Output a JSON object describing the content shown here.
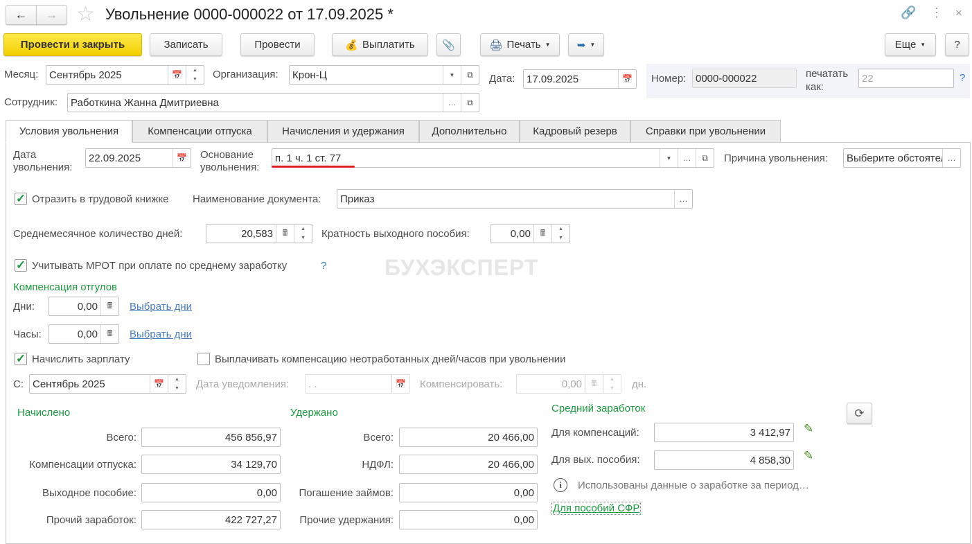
{
  "title": "Увольнение 0000-000022 от 17.09.2025 *",
  "toolbar": {
    "post_close": "Провести и закрыть",
    "save": "Записать",
    "post": "Провести",
    "pay": "Выплатить",
    "print": "Печать",
    "more": "Еще",
    "help": "?"
  },
  "header": {
    "month_label": "Месяц:",
    "month": "Сентябрь 2025",
    "org_label": "Организация:",
    "org": "Крон-Ц",
    "date_label": "Дата:",
    "date": "17.09.2025",
    "number_label": "Номер:",
    "number": "0000-000022",
    "print_as_label": "печатать как:",
    "print_as": "22",
    "help": "?",
    "employee_label": "Сотрудник:",
    "employee": "Работкина Жанна Дмитриевна"
  },
  "tabs": [
    "Условия увольнения",
    "Компенсации отпуска",
    "Начисления и удержания",
    "Дополнительно",
    "Кадровый резерв",
    "Справки при увольнении"
  ],
  "form": {
    "dismissal_date_label": "Дата увольнения:",
    "dismissal_date": "22.09.2025",
    "basis_label": "Основание увольнения:",
    "basis": "п. 1 ч. 1 ст. 77",
    "reason_label": "Причина увольнения:",
    "reason": "Выберите обстоятельства",
    "workbook_label": "Отразить в трудовой книжке",
    "workbook_checked": true,
    "docname_label": "Наименование документа:",
    "docname": "Приказ",
    "avg_days_label": "Среднемесячное количество дней:",
    "avg_days": "20,583",
    "severance_mult_label": "Кратность выходного пособия:",
    "severance_mult": "0,00",
    "mrot_label": "Учитывать МРОТ при оплате по среднему заработку",
    "mrot_checked": true,
    "mrot_help": "?",
    "timeoff_title": "Компенсация отгулов",
    "days_label": "Дни:",
    "days": "0,00",
    "hours_label": "Часы:",
    "hours": "0,00",
    "choose_days": "Выбрать дни",
    "accrue_label": "Начислить зарплату",
    "accrue_checked": true,
    "pay_comp_label": "Выплачивать компенсацию неотработанных дней/часов при увольнении",
    "pay_comp_checked": false,
    "from_label": "С:",
    "from": "Сентябрь 2025",
    "notice_label": "Дата уведомления:",
    "notice": " .  .",
    "compensate_label": "Компенсировать:",
    "compensate": "0,00",
    "days_unit": "дн."
  },
  "accrued": {
    "title": "Начислено",
    "rows": [
      {
        "label": "Всего:",
        "value": "456 856,97"
      },
      {
        "label": "Компенсации отпуска:",
        "value": "34 129,70"
      },
      {
        "label": "Выходное пособие:",
        "value": "0,00"
      },
      {
        "label": "Прочий заработок:",
        "value": "422 727,27"
      }
    ]
  },
  "withheld": {
    "title": "Удержано",
    "rows": [
      {
        "label": "Всего:",
        "value": "20 466,00"
      },
      {
        "label": "НДФЛ:",
        "value": "20 466,00"
      },
      {
        "label": "Погашение займов:",
        "value": "0,00"
      },
      {
        "label": "Прочие удержания:",
        "value": "0,00"
      }
    ]
  },
  "average": {
    "title": "Средний заработок",
    "comp_label": "Для компенсаций:",
    "comp": "3 412,97",
    "sev_label": "Для вых. пособия:",
    "sev": "4 858,30",
    "info": "Использованы данные о заработке за период…",
    "sfr_link": "Для пособий СФР"
  },
  "watermark": "БУХЭКСПЕРТ"
}
